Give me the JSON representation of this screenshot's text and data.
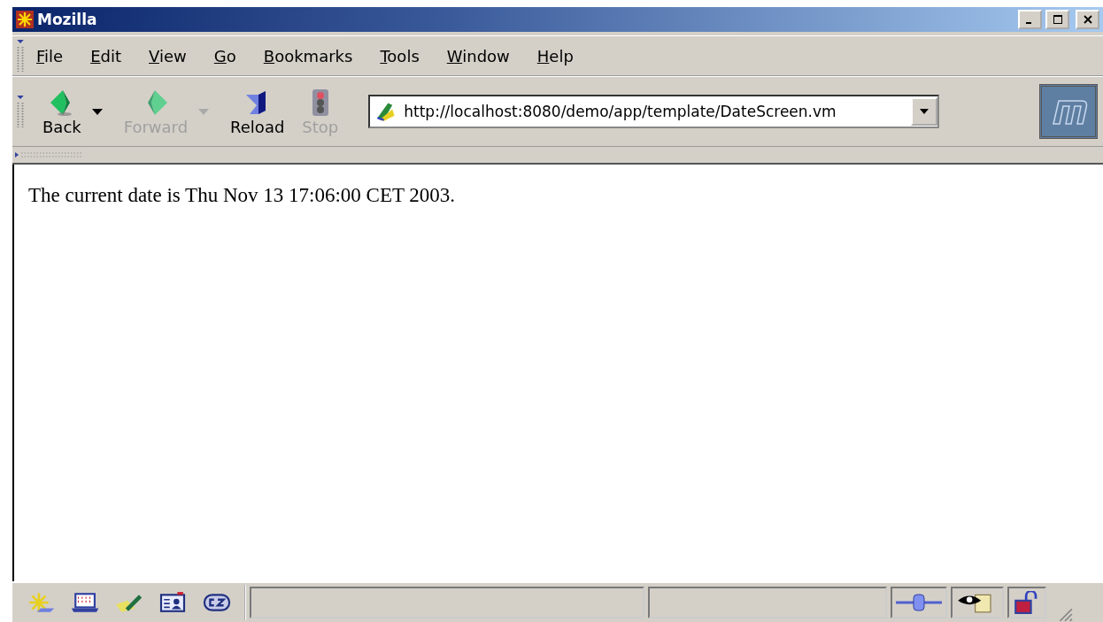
{
  "window": {
    "title": "Mozilla"
  },
  "menu": [
    {
      "label": "File"
    },
    {
      "label": "Edit"
    },
    {
      "label": "View"
    },
    {
      "label": "Go"
    },
    {
      "label": "Bookmarks"
    },
    {
      "label": "Tools"
    },
    {
      "label": "Window"
    },
    {
      "label": "Help"
    }
  ],
  "toolbar": [
    {
      "kind": "back",
      "label": "Back",
      "disabled": false,
      "dropdown": true
    },
    {
      "kind": "forward",
      "label": "Forward",
      "disabled": true,
      "dropdown": true
    },
    {
      "kind": "reload",
      "label": "Reload",
      "disabled": false,
      "dropdown": false
    },
    {
      "kind": "stop",
      "label": "Stop",
      "disabled": true,
      "dropdown": false
    }
  ],
  "address": {
    "value": "http://localhost:8080/demo/app/template/DateScreen.vm"
  },
  "content": {
    "text": "The current date is Thu Nov 13 17:06:00 CET 2003."
  }
}
